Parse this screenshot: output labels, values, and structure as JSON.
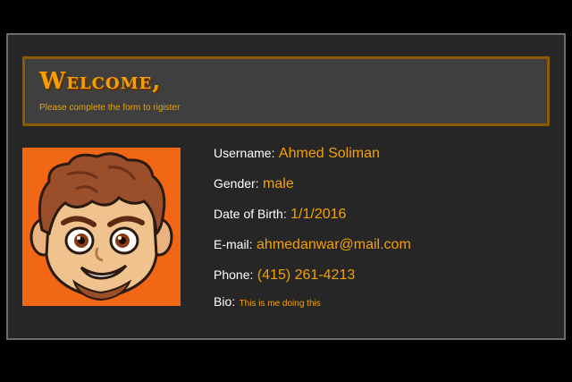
{
  "banner": {
    "title": "Welcome,",
    "subtitle": "Please complete the form to rigister"
  },
  "profile": {
    "avatar_icon": "cartoon-avatar-icon",
    "fields": [
      {
        "label": "Username:",
        "value": "Ahmed Soliman"
      },
      {
        "label": "Gender:",
        "value": "male"
      },
      {
        "label": "Date of Birth:",
        "value": "1/1/2016"
      },
      {
        "label": "E-mail:",
        "value": "ahmedanwar@mail.com"
      },
      {
        "label": "Phone:",
        "value": "(415) 261-4213"
      },
      {
        "label": "Bio:",
        "value": "This is me doing this"
      }
    ]
  },
  "colors": {
    "accent": "#f4a100",
    "avatar_bg": "#f26716",
    "banner_border": "#8a5a00"
  }
}
